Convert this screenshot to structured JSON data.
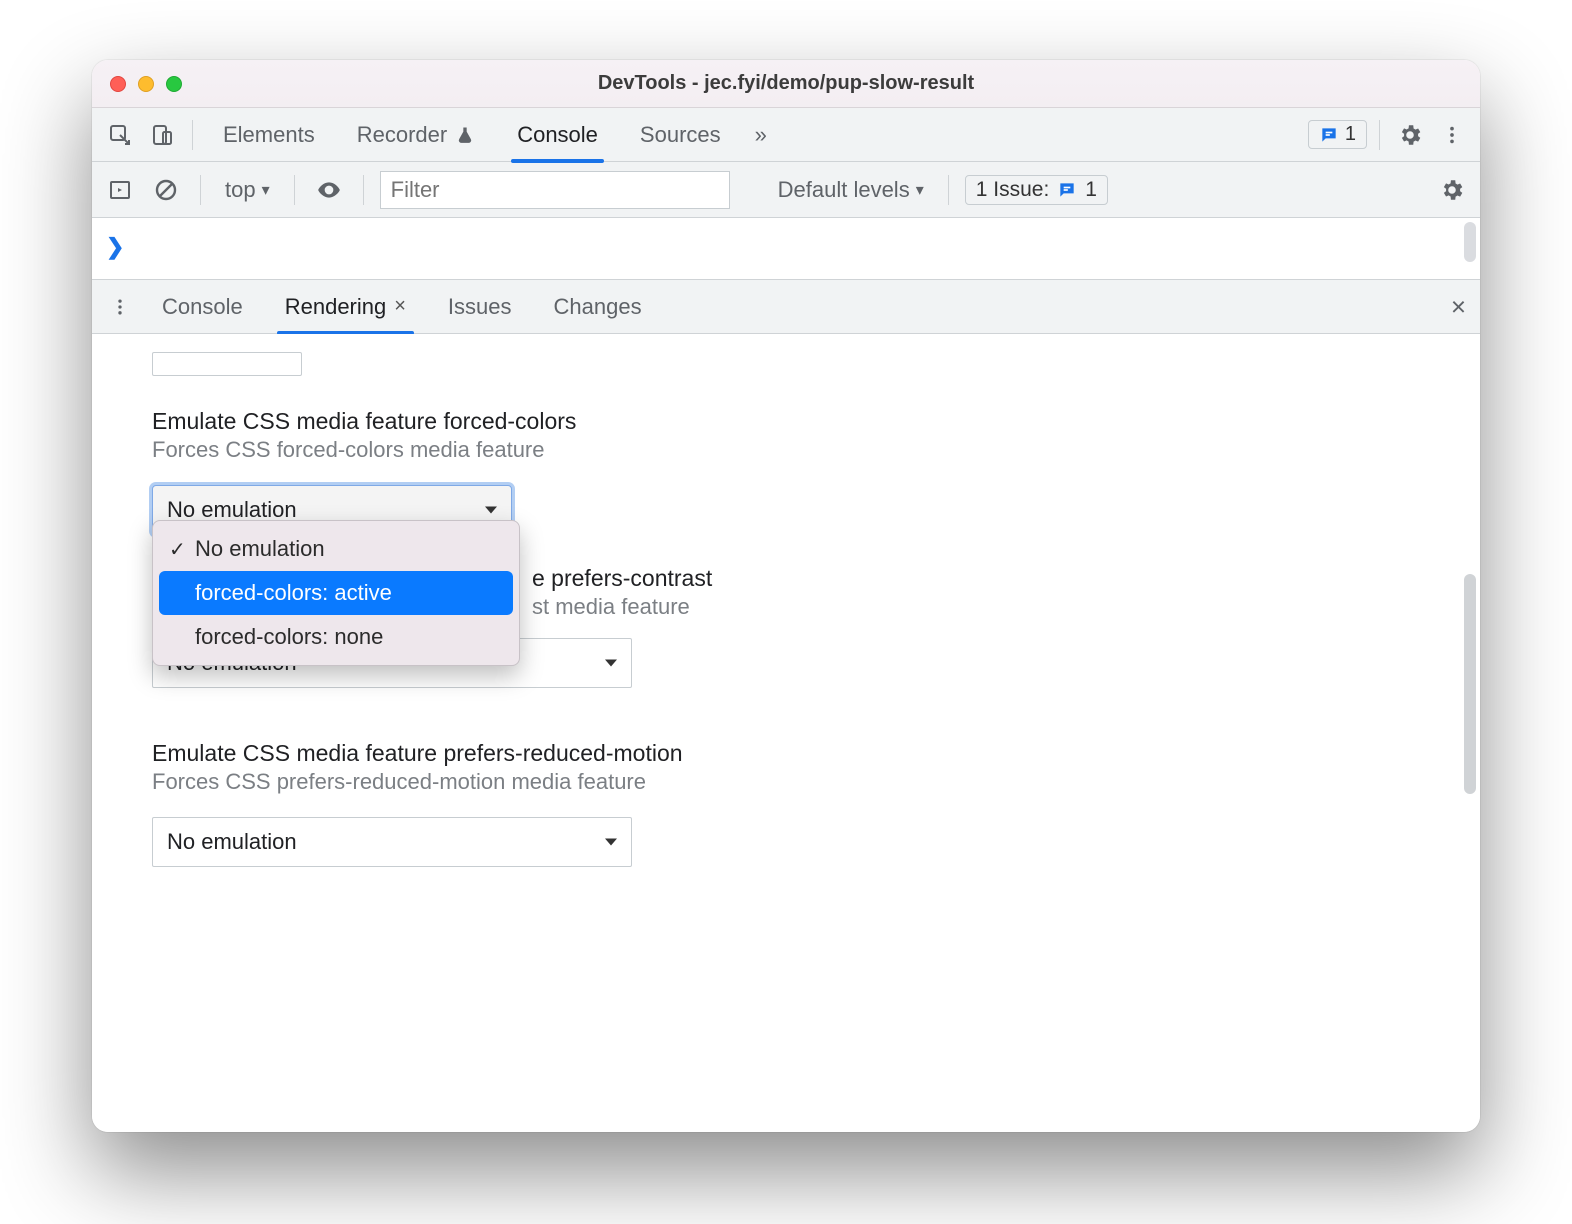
{
  "window": {
    "title": "DevTools - jec.fyi/demo/pup-slow-result"
  },
  "tabs": {
    "items": [
      "Elements",
      "Recorder",
      "Console",
      "Sources"
    ],
    "active": "Console",
    "more_glyph": "»",
    "issues_badge_count": "1"
  },
  "console_toolbar": {
    "context_label": "top",
    "filter_placeholder": "Filter",
    "levels_label": "Default levels",
    "issues_label": "1 Issue:",
    "issues_count": "1"
  },
  "console": {
    "prompt_glyph": "❯"
  },
  "drawer": {
    "tabs": [
      "Console",
      "Rendering",
      "Issues",
      "Changes"
    ],
    "active": "Rendering"
  },
  "rendering": {
    "forced_colors": {
      "title": "Emulate CSS media feature forced-colors",
      "subtitle": "Forces CSS forced-colors media feature",
      "value": "No emulation",
      "options": [
        "No emulation",
        "forced-colors: active",
        "forced-colors: none"
      ],
      "selected_index": 0,
      "highlight_index": 1
    },
    "prefers_contrast": {
      "title_tail": "e prefers-contrast",
      "subtitle_tail": "st media feature",
      "value": "No emulation"
    },
    "prefers_reduced_motion": {
      "title": "Emulate CSS media feature prefers-reduced-motion",
      "subtitle": "Forces CSS prefers-reduced-motion media feature",
      "value": "No emulation"
    }
  },
  "glyphs": {
    "check": "✓",
    "close": "×",
    "caret_down": "▾"
  }
}
